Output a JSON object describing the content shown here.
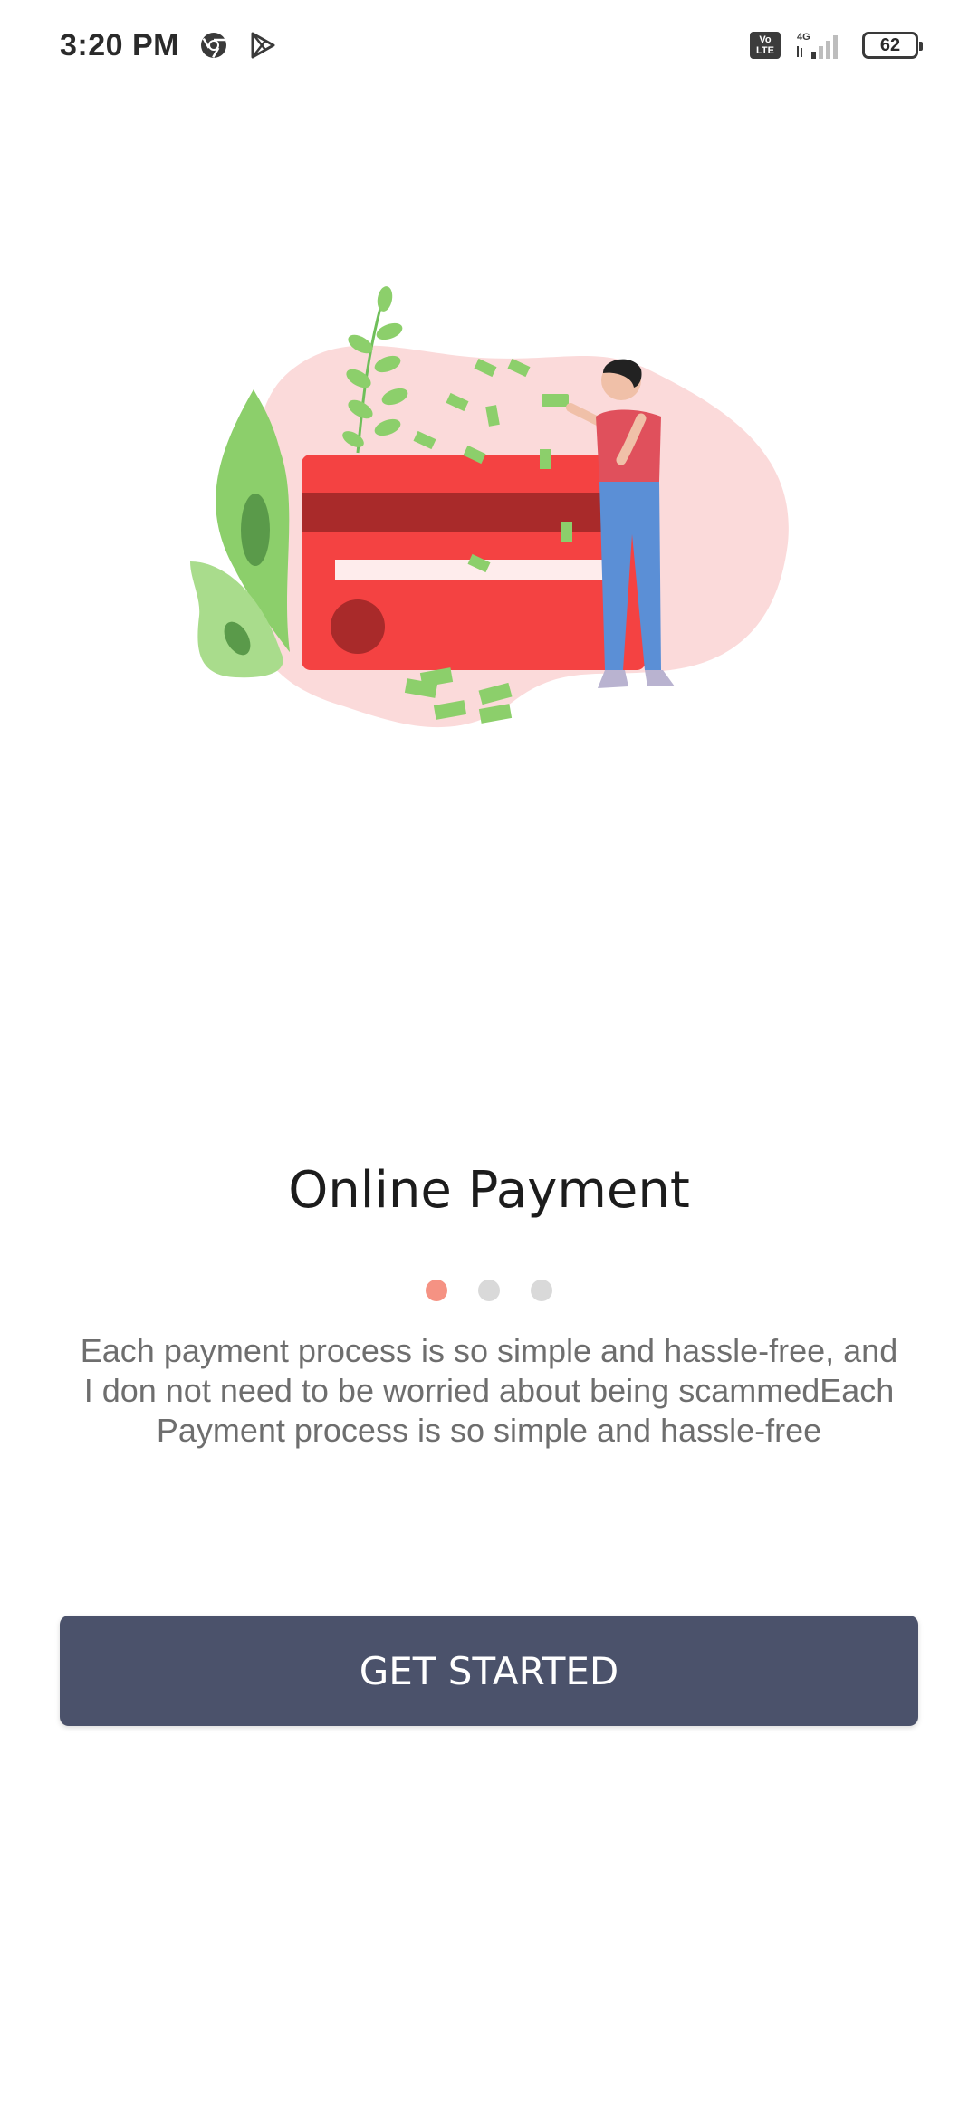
{
  "status_bar": {
    "time": "3:20 PM",
    "network": "4G",
    "volte_line1": "Vo",
    "volte_line2": "LTE",
    "battery": "62",
    "icons": [
      "chrome-icon",
      "play-store-icon",
      "volte-icon",
      "signal-icon",
      "battery-icon"
    ]
  },
  "onboarding": {
    "illustration": "credit-card-payment-illustration",
    "title": "Online Payment",
    "description": "Each payment process is so simple and hassle-free, and I don not need to be worried about being scammedEach Payment process is so simple and hassle-free",
    "pager": {
      "total": 3,
      "active_index": 0
    },
    "button_label": "GET STARTED"
  },
  "colors": {
    "button": "#4b526b",
    "dot_active": "#f59283",
    "dot_inactive": "#d9d9d9",
    "card": "#f44242",
    "card_stripe": "#a92a2a",
    "blob": "#fbdada",
    "leaf": "#8ccf6b"
  }
}
